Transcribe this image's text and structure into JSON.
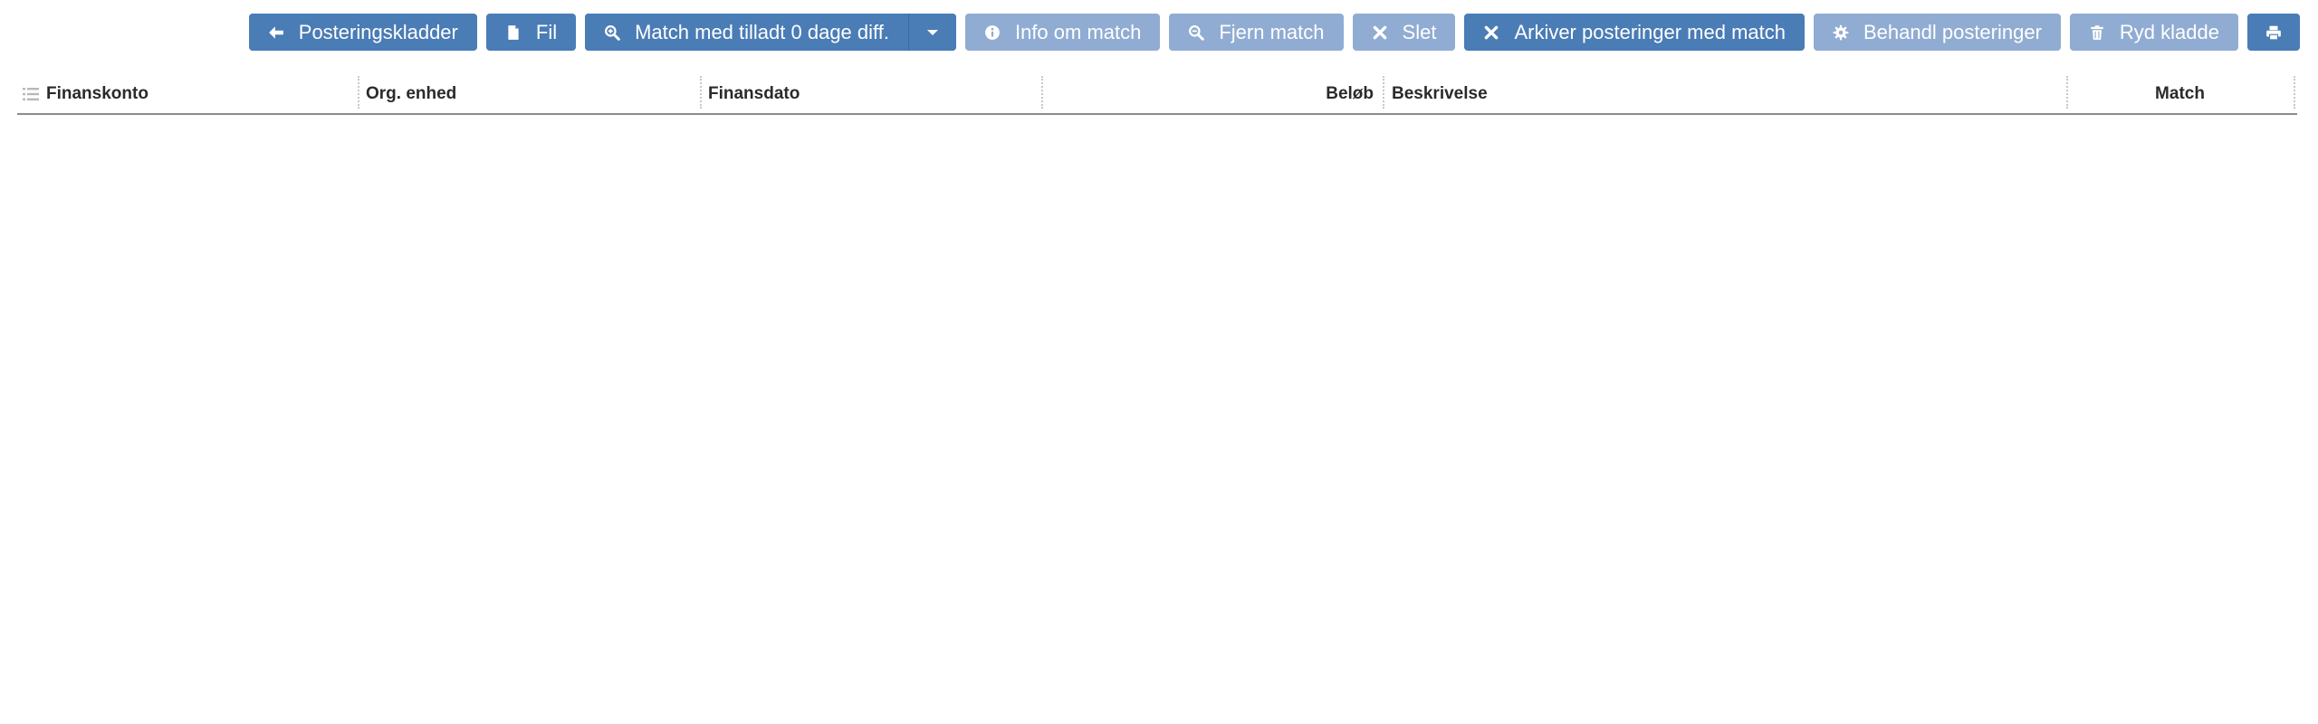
{
  "toolbar": {
    "buttons": [
      {
        "label": "Posteringskladder",
        "icon": "arrow-left-icon"
      },
      {
        "label": "Fil",
        "icon": "file-icon"
      },
      {
        "label": "Match med tilladt 0 dage diff.",
        "icon": "zoom-in-icon"
      },
      {
        "label": "Info om match",
        "icon": "info-icon"
      },
      {
        "label": "Fjern match",
        "icon": "zoom-out-icon"
      },
      {
        "label": "Slet",
        "icon": "close-icon"
      },
      {
        "label": "Arkiver posteringer med match",
        "icon": "close-icon"
      },
      {
        "label": "Behandl posteringer",
        "icon": "gear-icon"
      },
      {
        "label": "Ryd kladde",
        "icon": "trash-icon"
      },
      {
        "label": "",
        "icon": "print-icon"
      }
    ],
    "colors": {
      "primary": "#4a7cb6",
      "disabled": "#90acd2"
    }
  },
  "table": {
    "columns": [
      {
        "label": "Finanskonto"
      },
      {
        "label": "Org. enhed"
      },
      {
        "label": "Finansdato"
      },
      {
        "label": "Beløb"
      },
      {
        "label": "Beskrivelse"
      },
      {
        "label": "Match"
      }
    ],
    "rows": []
  }
}
